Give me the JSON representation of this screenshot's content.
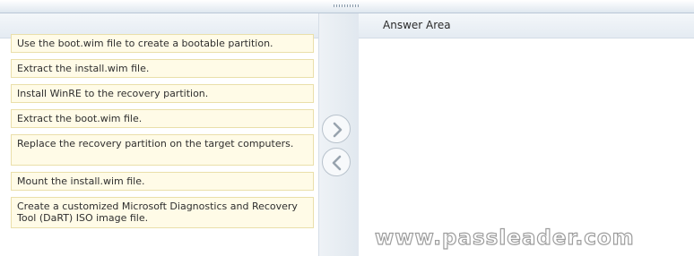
{
  "answer_area": {
    "title": "Answer Area",
    "items": []
  },
  "source_items": [
    "Use the boot.wim file to create a bootable partition.",
    "Extract the install.wim file.",
    "Install WinRE to the recovery partition.",
    "Extract the boot.wim file.",
    "Replace the recovery partition on the target computers.",
    "Mount the install.wim file.",
    "Create a customized Microsoft Diagnostics and Recovery Tool (DaRT) ISO image file."
  ],
  "controls": {
    "move_right_icon": "chevron-right-icon",
    "move_left_icon": "chevron-left-icon"
  },
  "watermark": "www.passleader.com"
}
